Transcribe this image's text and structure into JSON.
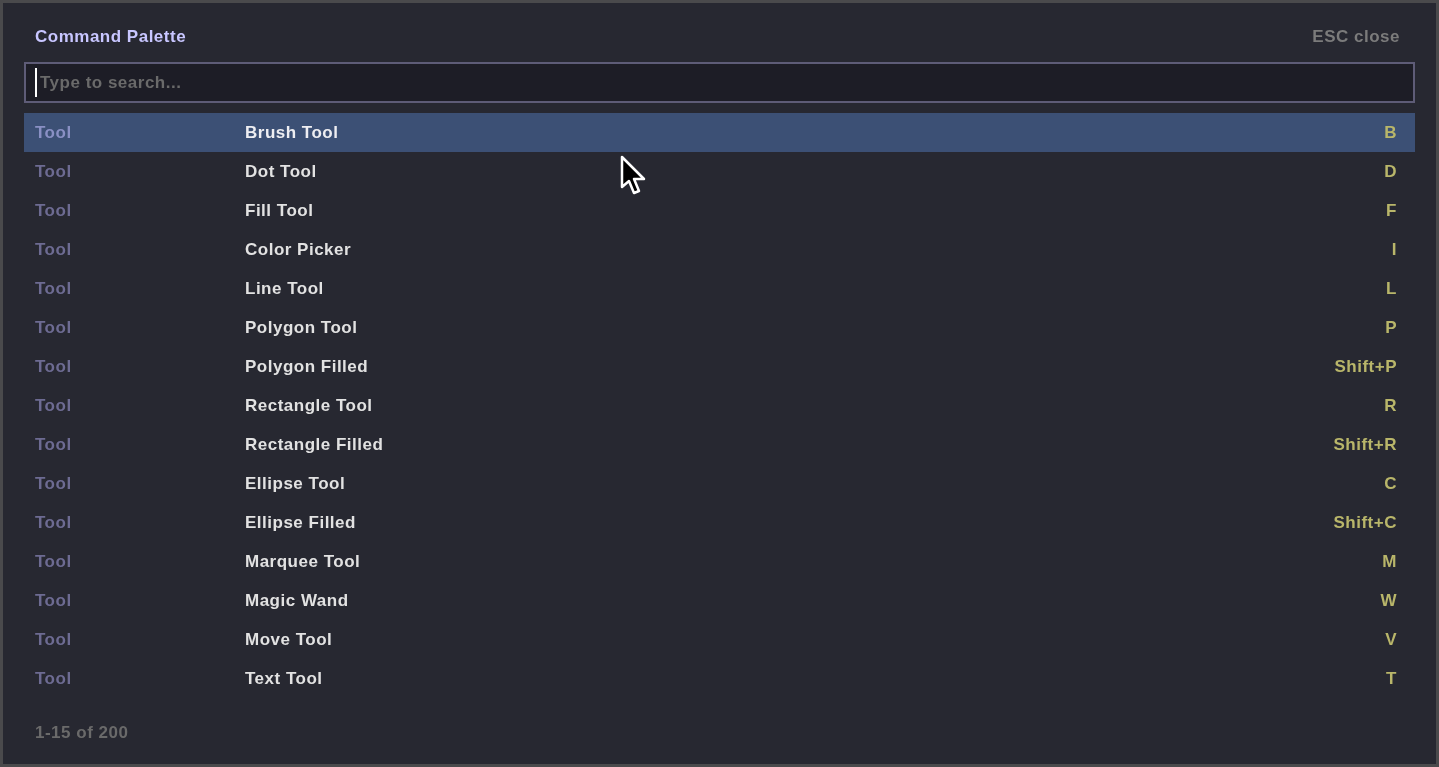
{
  "palette": {
    "title": "Command Palette",
    "close_hint": "ESC close",
    "search": {
      "placeholder": "Type to search...",
      "focused": true
    },
    "results": [
      {
        "category": "Tool",
        "name": "Brush Tool",
        "shortcut": "B",
        "selected": true
      },
      {
        "category": "Tool",
        "name": "Dot Tool",
        "shortcut": "D",
        "selected": false
      },
      {
        "category": "Tool",
        "name": "Fill Tool",
        "shortcut": "F",
        "selected": false
      },
      {
        "category": "Tool",
        "name": "Color Picker",
        "shortcut": "I",
        "selected": false
      },
      {
        "category": "Tool",
        "name": "Line Tool",
        "shortcut": "L",
        "selected": false
      },
      {
        "category": "Tool",
        "name": "Polygon Tool",
        "shortcut": "P",
        "selected": false
      },
      {
        "category": "Tool",
        "name": "Polygon Filled",
        "shortcut": "Shift+P",
        "selected": false
      },
      {
        "category": "Tool",
        "name": "Rectangle Tool",
        "shortcut": "R",
        "selected": false
      },
      {
        "category": "Tool",
        "name": "Rectangle Filled",
        "shortcut": "Shift+R",
        "selected": false
      },
      {
        "category": "Tool",
        "name": "Ellipse Tool",
        "shortcut": "C",
        "selected": false
      },
      {
        "category": "Tool",
        "name": "Ellipse Filled",
        "shortcut": "Shift+C",
        "selected": false
      },
      {
        "category": "Tool",
        "name": "Marquee Tool",
        "shortcut": "M",
        "selected": false
      },
      {
        "category": "Tool",
        "name": "Magic Wand",
        "shortcut": "W",
        "selected": false
      },
      {
        "category": "Tool",
        "name": "Move Tool",
        "shortcut": "V",
        "selected": false
      },
      {
        "category": "Tool",
        "name": "Text Tool",
        "shortcut": "T",
        "selected": false
      }
    ],
    "footer": "1-15 of 200"
  }
}
